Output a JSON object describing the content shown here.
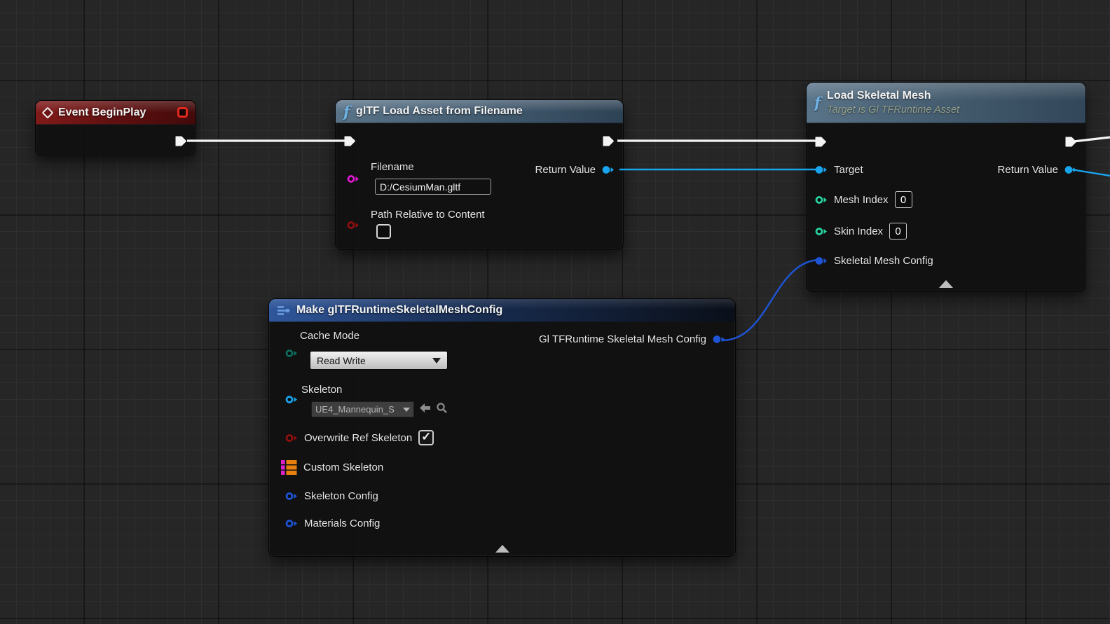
{
  "colors": {
    "background": "#262626",
    "grid_minor": "#2e2e2e",
    "grid_major": "#161616",
    "exec_wire": "#f4f4f4",
    "object_wire": "#18a5ee",
    "struct_wire": "#1d55d6",
    "pin_string": "#df19d4",
    "pin_bool": "#910f0f",
    "pin_int": "#27d6a0",
    "pin_object": "#18a5ee",
    "pin_struct": "#1d55d6",
    "pin_enum": "#0c6e5f",
    "map_key": "#e020c8",
    "map_value": "#e8800e",
    "event_header": "#6b1010",
    "function_header": "#4d687e",
    "make_header": "#2c5293"
  },
  "glyphs": {
    "function_icon": "f",
    "check": "✓"
  },
  "nodes": {
    "event_begin_play": {
      "title": "Event BeginPlay",
      "icon": "event-diamond-icon",
      "marker_icon": "red-square-marker"
    },
    "gltf_load_asset": {
      "title": "glTF Load Asset from Filename",
      "icon": "function-f-icon",
      "pins": {
        "filename": {
          "label": "Filename",
          "value": "D:/CesiumMan.gltf",
          "type": "string"
        },
        "path_relative_to_content": {
          "label": "Path Relative to Content",
          "checked": false,
          "type": "bool"
        },
        "return_value": {
          "label": "Return Value",
          "type": "object",
          "connected": true
        }
      }
    },
    "load_skeletal_mesh": {
      "title": "Load Skeletal Mesh",
      "subtitle": "Target is Gl TFRuntime Asset",
      "icon": "function-f-icon",
      "pins": {
        "target": {
          "label": "Target",
          "type": "object",
          "connected": true
        },
        "mesh_index": {
          "label": "Mesh Index",
          "value": "0",
          "type": "int"
        },
        "skin_index": {
          "label": "Skin Index",
          "value": "0",
          "type": "int"
        },
        "skeletal_mesh_config": {
          "label": "Skeletal Mesh Config",
          "type": "struct",
          "connected": true
        },
        "return_value": {
          "label": "Return Value",
          "type": "object",
          "connected": true
        }
      }
    },
    "make_config": {
      "title": "Make glTFRuntimeSkeletalMeshConfig",
      "icon": "make-struct-icon",
      "pins": {
        "cache_mode": {
          "label": "Cache Mode",
          "value": "Read Write",
          "type": "enum"
        },
        "skeleton": {
          "label": "Skeleton",
          "value": "UE4_Mannequin_S",
          "type": "object"
        },
        "overwrite_ref_skeleton": {
          "label": "Overwrite Ref Skeleton",
          "checked": true,
          "type": "bool"
        },
        "custom_skeleton": {
          "label": "Custom Skeleton",
          "type": "map"
        },
        "skeleton_config": {
          "label": "Skeleton Config",
          "type": "struct"
        },
        "materials_config": {
          "label": "Materials Config",
          "type": "struct"
        },
        "output_config": {
          "label": "Gl TFRuntime Skeletal Mesh Config",
          "type": "struct",
          "connected": true
        }
      }
    }
  }
}
